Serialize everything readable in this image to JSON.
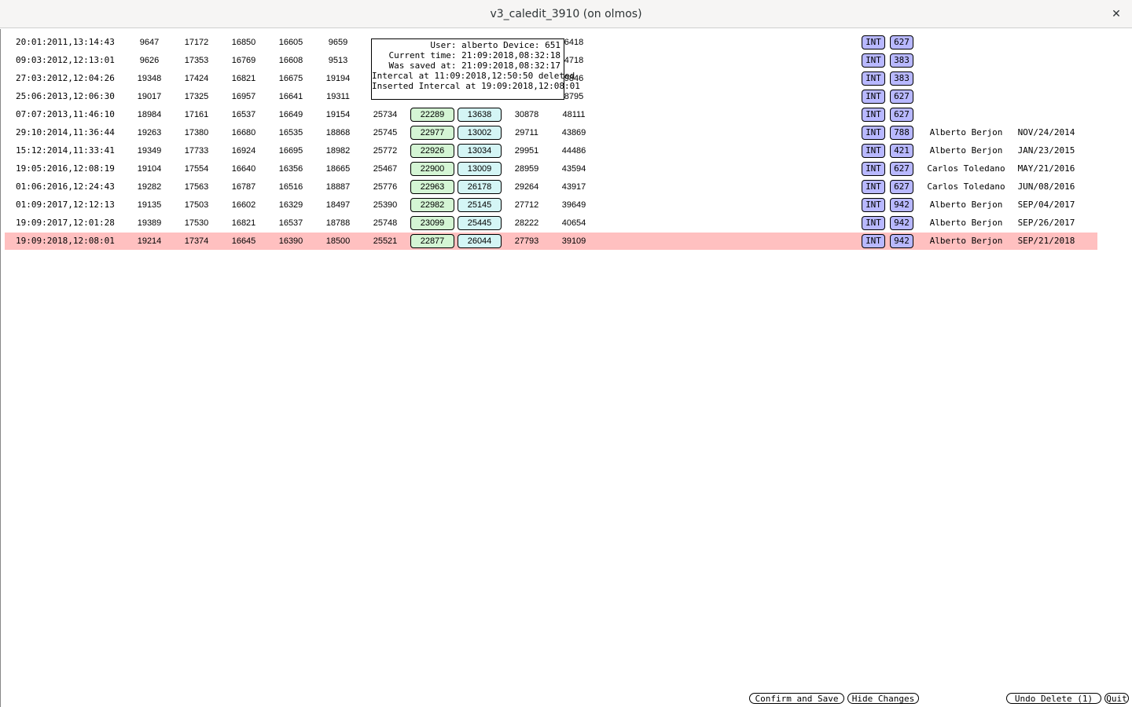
{
  "window": {
    "title": "v3_caledit_3910 (on olmos)",
    "close_glyph": "✕"
  },
  "rows": [
    {
      "ts": "20:01:2011,13:14:43",
      "c1": "9647",
      "c2": "17172",
      "c3": "16850",
      "c4": "16605",
      "c5": "9659",
      "c6": "",
      "g": "",
      "c": "",
      "c7": "",
      "c8": "6418",
      "type": "INT",
      "code": "627",
      "name": "",
      "date": "",
      "highlight": false
    },
    {
      "ts": "09:03:2012,12:13:01",
      "c1": "9626",
      "c2": "17353",
      "c3": "16769",
      "c4": "16608",
      "c5": "9513",
      "c6": "",
      "g": "",
      "c": "",
      "c7": "",
      "c8": "4718",
      "type": "INT",
      "code": "383",
      "name": "",
      "date": "",
      "highlight": false
    },
    {
      "ts": "27:03:2012,12:04:26",
      "c1": "19348",
      "c2": "17424",
      "c3": "16821",
      "c4": "16675",
      "c5": "19194",
      "c6": "",
      "g": "",
      "c": "",
      "c7": "",
      "c8": "9846",
      "type": "INT",
      "code": "383",
      "name": "",
      "date": "",
      "highlight": false
    },
    {
      "ts": "25:06:2013,12:06:30",
      "c1": "19017",
      "c2": "17325",
      "c3": "16957",
      "c4": "16641",
      "c5": "19311",
      "c6": "",
      "g": "",
      "c": "",
      "c7": "",
      "c8": "8795",
      "type": "INT",
      "code": "627",
      "name": "",
      "date": "",
      "highlight": false
    },
    {
      "ts": "07:07:2013,11:46:10",
      "c1": "18984",
      "c2": "17161",
      "c3": "16537",
      "c4": "16649",
      "c5": "19154",
      "c6": "25734",
      "g": "22289",
      "c": "13638",
      "c7": "30878",
      "c8": "48111",
      "type": "INT",
      "code": "627",
      "name": "",
      "date": "",
      "highlight": false
    },
    {
      "ts": "29:10:2014,11:36:44",
      "c1": "19263",
      "c2": "17380",
      "c3": "16680",
      "c4": "16535",
      "c5": "18868",
      "c6": "25745",
      "g": "22977",
      "c": "13002",
      "c7": "29711",
      "c8": "43869",
      "type": "INT",
      "code": "788",
      "name": "Alberto Berjon",
      "date": "NOV/24/2014",
      "highlight": false
    },
    {
      "ts": "15:12:2014,11:33:41",
      "c1": "19349",
      "c2": "17733",
      "c3": "16924",
      "c4": "16695",
      "c5": "18982",
      "c6": "25772",
      "g": "22926",
      "c": "13034",
      "c7": "29951",
      "c8": "44486",
      "type": "INT",
      "code": "421",
      "name": "Alberto Berjon",
      "date": "JAN/23/2015",
      "highlight": false
    },
    {
      "ts": "19:05:2016,12:08:19",
      "c1": "19104",
      "c2": "17554",
      "c3": "16640",
      "c4": "16356",
      "c5": "18665",
      "c6": "25467",
      "g": "22900",
      "c": "13009",
      "c7": "28959",
      "c8": "43594",
      "type": "INT",
      "code": "627",
      "name": "Carlos Toledano",
      "date": "MAY/21/2016",
      "highlight": false
    },
    {
      "ts": "01:06:2016,12:24:43",
      "c1": "19282",
      "c2": "17563",
      "c3": "16787",
      "c4": "16516",
      "c5": "18887",
      "c6": "25776",
      "g": "22963",
      "c": "26178",
      "c7": "29264",
      "c8": "43917",
      "type": "INT",
      "code": "627",
      "name": "Carlos Toledano",
      "date": "JUN/08/2016",
      "highlight": false
    },
    {
      "ts": "01:09:2017,12:12:13",
      "c1": "19135",
      "c2": "17503",
      "c3": "16602",
      "c4": "16329",
      "c5": "18497",
      "c6": "25390",
      "g": "22982",
      "c": "25145",
      "c7": "27712",
      "c8": "39649",
      "type": "INT",
      "code": "942",
      "name": "Alberto Berjon",
      "date": "SEP/04/2017",
      "highlight": false
    },
    {
      "ts": "19:09:2017,12:01:28",
      "c1": "19389",
      "c2": "17530",
      "c3": "16821",
      "c4": "16537",
      "c5": "18788",
      "c6": "25748",
      "g": "23099",
      "c": "25445",
      "c7": "28222",
      "c8": "40654",
      "type": "INT",
      "code": "942",
      "name": "Alberto Berjon",
      "date": "SEP/26/2017",
      "highlight": false
    },
    {
      "ts": "19:09:2018,12:08:01",
      "c1": "19214",
      "c2": "17374",
      "c3": "16645",
      "c4": "16390",
      "c5": "18500",
      "c6": "25521",
      "g": "22877",
      "c": "26044",
      "c7": "27793",
      "c8": "39109",
      "type": "INT",
      "code": "942",
      "name": "Alberto Berjon",
      "date": "SEP/21/2018",
      "highlight": true
    }
  ],
  "tooltip": {
    "lines": [
      "User: alberto Device: 651",
      "Current time: 21:09:2018,08:32:18",
      "Was saved at: 21:09:2018,08:32:17",
      "Intercal at 11:09:2018,12:50:50 deleted",
      "Inserted Intercal at 19:09:2018,12:08:01"
    ]
  },
  "buttons": {
    "confirm_save": "Confirm and Save",
    "hide_changes": "Hide Changes",
    "undo_delete": "Undo Delete (1)",
    "quit": "Quit"
  },
  "colors": {
    "highlight_row": "#ffc0c0",
    "green_box": "#d4f5d4",
    "cyan_box": "#d4f5f5",
    "tag_blue": "#b8b8ff"
  }
}
